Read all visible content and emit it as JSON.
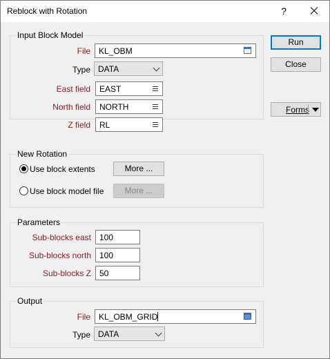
{
  "window": {
    "title": "Reblock with Rotation",
    "help_label": "?"
  },
  "input_block_model": {
    "group_title": "Input Block Model",
    "file_label": "File",
    "file_value": "KL_OBM",
    "type_label": "Type",
    "type_value": "DATA",
    "east_label": "East field",
    "east_value": "EAST",
    "north_label": "North field",
    "north_value": "NORTH",
    "z_label": "Z field",
    "z_value": "RL"
  },
  "new_rotation": {
    "group_title": "New Rotation",
    "option1_label": "Use block extents",
    "option1_selected": true,
    "option2_label": "Use block model file",
    "option2_selected": false,
    "more1_label": "More ...",
    "more2_label": "More ..."
  },
  "parameters": {
    "group_title": "Parameters",
    "east_label": "Sub-blocks east",
    "east_value": "100",
    "north_label": "Sub-blocks north",
    "north_value": "100",
    "z_label": "Sub-blocks Z",
    "z_value": "50"
  },
  "output": {
    "group_title": "Output",
    "file_label": "File",
    "file_value": "KL_OBM_GRID",
    "type_label": "Type",
    "type_value": "DATA"
  },
  "actions": {
    "run_label": "Run",
    "close_label": "Close",
    "forms_label": "Forms"
  },
  "colors": {
    "required_label": "#8b1a1a",
    "primary_border": "#0078d7"
  }
}
